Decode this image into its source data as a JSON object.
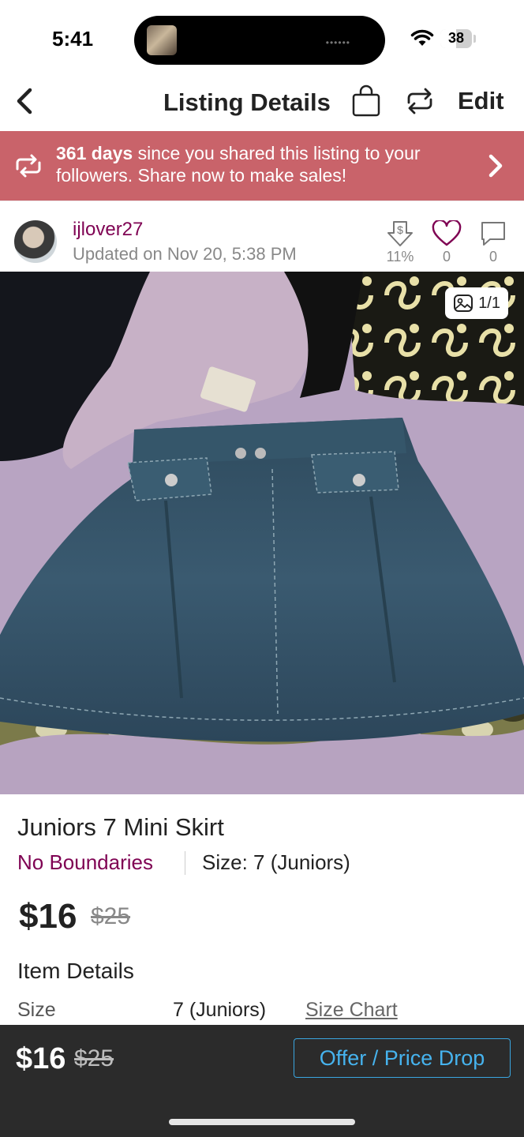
{
  "status_bar": {
    "time": "5:41",
    "battery": "38"
  },
  "nav": {
    "title": "Listing Details",
    "edit_label": "Edit"
  },
  "banner": {
    "days": "361 days",
    "message": " since you shared this listing to your followers. Share now to make sales!"
  },
  "seller": {
    "username": "ijlover27",
    "updated": "Updated on Nov 20, 5:38 PM",
    "price_drop_stat": "11%",
    "likes": "0",
    "comments": "0"
  },
  "photo": {
    "counter": "1/1"
  },
  "listing": {
    "title": "Juniors 7 Mini Skirt",
    "brand": "No Boundaries",
    "size": "Size: 7 (Juniors)",
    "price": "$16",
    "original_price": "$25"
  },
  "item_details": {
    "heading": "Item Details",
    "rows": [
      {
        "label": "Size",
        "value": "7 (Juniors)",
        "link": "Size Chart"
      }
    ]
  },
  "bottom_bar": {
    "price": "$16",
    "original_price": "$25",
    "offer_label": "Offer / Price Drop"
  },
  "colors": {
    "brand": "#7f0353",
    "banner": "#c9636a",
    "offer_button": "#46b3ee",
    "bottom_bar": "#2b2b2b"
  },
  "icons": {
    "back": "chevron-left-icon",
    "bag": "shopping-bag-icon",
    "share": "repost-icon",
    "banner": "repost-icon",
    "banner_arrow": "chevron-right-icon",
    "price_drop": "price-drop-tag-icon",
    "like": "heart-icon",
    "comment": "comment-icon",
    "photo_count": "image-stack-icon"
  }
}
